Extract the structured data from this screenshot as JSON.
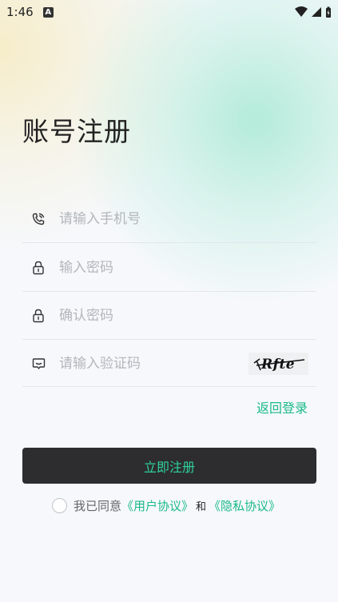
{
  "status_bar": {
    "time": "1:46",
    "notif_badge": "A"
  },
  "page": {
    "title": "账号注册"
  },
  "form": {
    "phone_placeholder": "请输入手机号",
    "password_placeholder": "输入密码",
    "confirm_placeholder": "确认密码",
    "code_placeholder": "请输入验证码",
    "captcha_text": "Rfte"
  },
  "actions": {
    "back_to_login": "返回登录",
    "submit_label": "立即注册"
  },
  "agreement": {
    "prefix": "我已同意",
    "user_agreement": "《用户协议》",
    "and": "和",
    "privacy_policy": "《隐私协议》"
  },
  "colors": {
    "accent": "#1bb98a",
    "button_bg": "#2d2d2f",
    "button_text": "#2fd39b"
  }
}
